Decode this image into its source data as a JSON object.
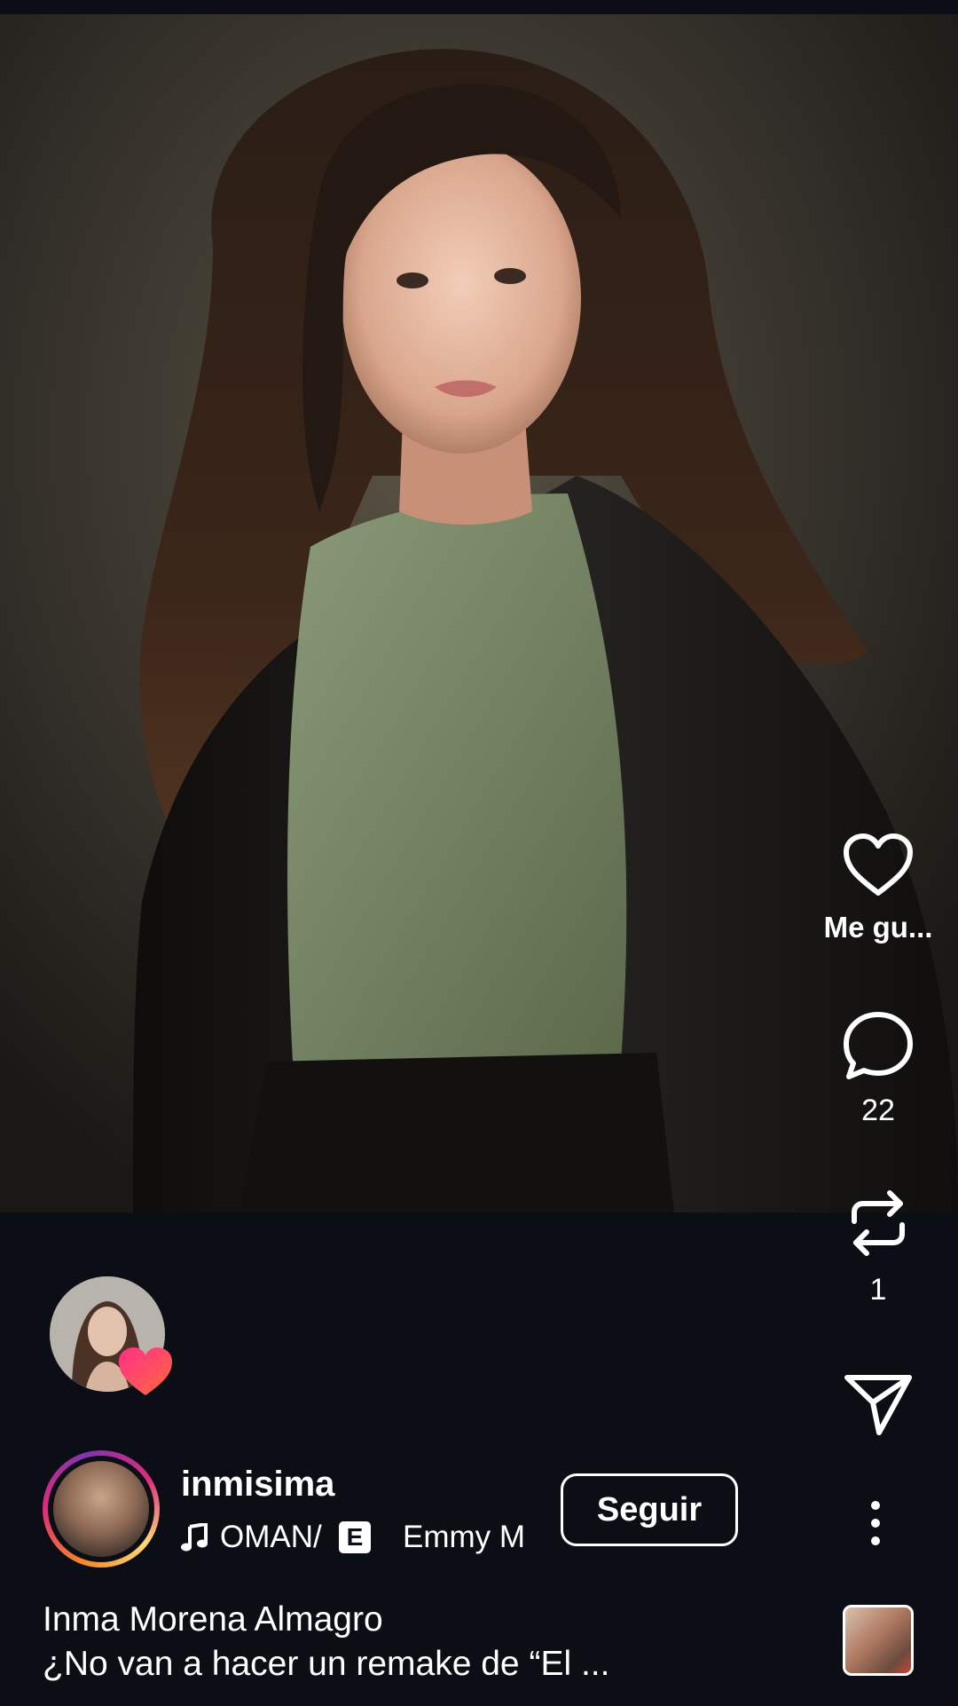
{
  "reel": {
    "photo_alt": "Portrait photo"
  },
  "actions": {
    "like_label": "Me gu...",
    "comment_count": "22",
    "repost_count": "1"
  },
  "author": {
    "username": "inmisima",
    "follow_label": "Seguir",
    "music": {
      "song": "/OMAN",
      "explicit_badge": "E",
      "artist": "Emmy M"
    }
  },
  "caption": {
    "line1": "Inma Morena Almagro",
    "line2": "¿No van a hacer un remake de “El ..."
  },
  "icons": {
    "like": "heart-outline-icon",
    "comment": "speech-bubble-icon",
    "repost": "repost-arrows-icon",
    "share": "paper-plane-icon",
    "more": "vertical-ellipsis-icon",
    "music": "music-note-icon",
    "liked_badge": "heart-filled-icon"
  },
  "colors": {
    "background": "#0b0e15",
    "story_ring_start": "#f58529",
    "story_ring_end": "#dd2a7b",
    "heart_badge": "#ff3b6b"
  }
}
